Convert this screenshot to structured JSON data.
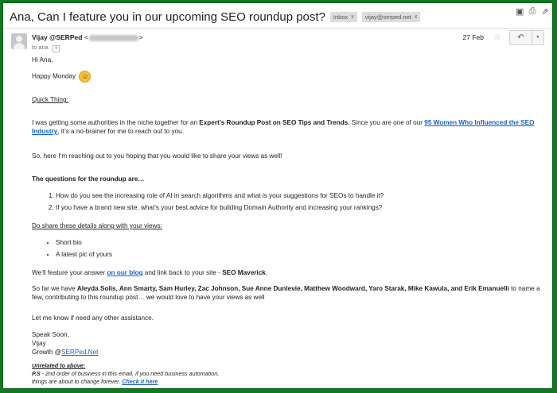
{
  "subject": "Ana, Can I feature you in our upcoming SEO roundup post?",
  "labels": [
    {
      "text": "Inbox",
      "close": "x"
    },
    {
      "text": "vijay@serped.net",
      "close": "x"
    }
  ],
  "top_icons": {
    "archive": "▣",
    "print": "⎙",
    "popout": "⇗"
  },
  "sender": {
    "name": "Vijay @SERPed",
    "open_bracket": "<",
    "close_bracket": ">"
  },
  "to_line": "to ana",
  "to_dropdown": "▾",
  "date": "27 Feb",
  "star": "☆",
  "reply_icon": "↶",
  "more_icon": "▾",
  "body": {
    "greeting": "Hi Ana,",
    "happy": "Happy Monday",
    "emoji": "☺",
    "quick_thing": "Quick Thing:",
    "p1_a": "I was getting some authorities in the niche together for an ",
    "p1_bold": "Expert’s Roundup Post on SEO Tips and Trends",
    "p1_b": ". Since you are one of our ",
    "p1_link": "95 Women Who Influenced the SEO Industry",
    "p1_c": ", it’s a no-brainer for me to reach out to you.",
    "p2": "So, here I’m reaching out to you hoping that you would like to share your views as well!",
    "questions_heading": "The questions for the roundup are…",
    "questions": [
      "How do you see the increasing role of AI in search algorithms and what is your suggestions for SEOs to handle it?",
      "If you have a brand new site, what’s your best advice for building Domain Authority and increasing your rankings?"
    ],
    "details_heading": "Do share these details along with your views:",
    "details": [
      "Short bio",
      "A latest pic of yours"
    ],
    "feature_a": "We’ll feature your answer ",
    "feature_link": "on our blog",
    "feature_b": " and link back to your site - ",
    "feature_bold": "SEO Maverick",
    "feature_c": ".",
    "sofar_a": "So far we have ",
    "sofar_bold": "Aleyda Solis, Ann Smarty, Sam Hurley, Zac Johnson, Sue Anne Dunlevie, Matthew Woodward, Yaro Starak, Mike Kawula, and Erik Emanuelli",
    "sofar_b": " to name a few, contributing to this roundup post… we would love to have your views  as well",
    "assist": "Let me know if need any other assistance.",
    "sign1": "Speak Soon,",
    "sign2": "Vijay",
    "sign3_a": "Growth @",
    "sign3_link": "SERPed.Net",
    "unrelated": "Unrelated to above:",
    "ps_label": "P.S",
    "ps_text": " - 2nd order of business in this email, if you need business automation,",
    "ps_text2": "things are about to change forever. ",
    "ps_link": "Check it here"
  }
}
